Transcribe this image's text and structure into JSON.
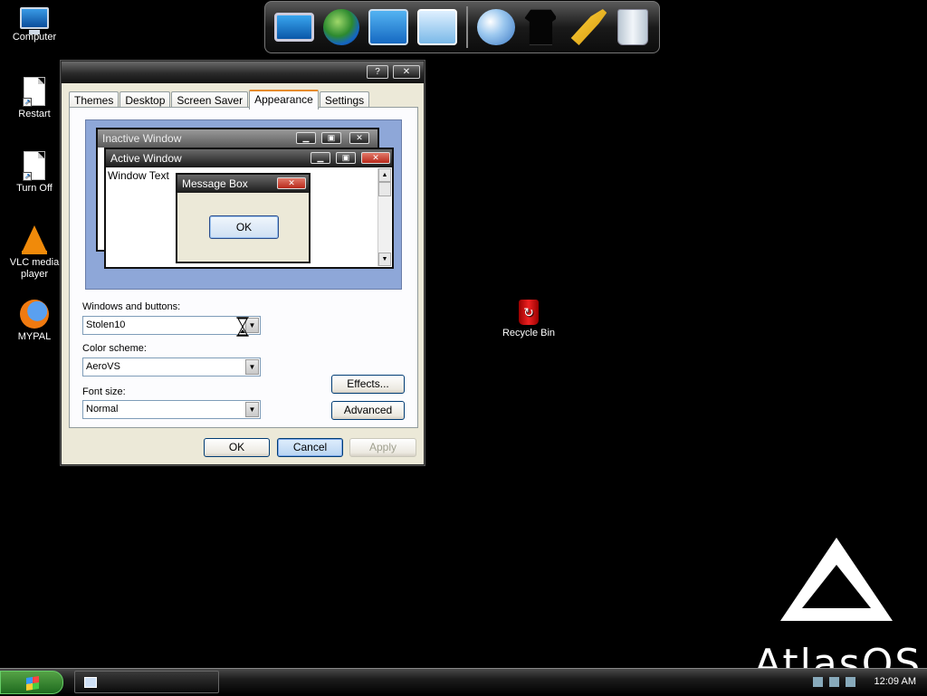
{
  "desktop": {
    "icons": [
      {
        "label": "Computer"
      },
      {
        "label": "Restart"
      },
      {
        "label": "Turn Off"
      },
      {
        "label": "VLC media player"
      },
      {
        "label": "MYPAL"
      },
      {
        "label": "Recycle Bin"
      }
    ]
  },
  "dock": {
    "items": [
      "monitor-icon",
      "globe-network-icon",
      "files-icon",
      "chart-icon",
      "internet-icon",
      "shirt-icon",
      "tools-icon",
      "recycle-bin-icon"
    ]
  },
  "dialog": {
    "help_label": "?",
    "close_label": "✕",
    "tabs": [
      {
        "label": "Themes"
      },
      {
        "label": "Desktop"
      },
      {
        "label": "Screen Saver"
      },
      {
        "label": "Appearance",
        "active": true
      },
      {
        "label": "Settings"
      }
    ],
    "preview": {
      "inactive_title": "Inactive Window",
      "active_title": "Active Window",
      "window_text": "Window Text",
      "message_title": "Message Box",
      "message_ok": "OK"
    },
    "windows_buttons": {
      "label": "Windows and buttons:",
      "value": "Stolen10"
    },
    "color_scheme": {
      "label": "Color scheme:",
      "value": "AeroVS"
    },
    "font_size": {
      "label": "Font size:",
      "value": "Normal"
    },
    "effects_label": "Effects...",
    "advanced_label": "Advanced",
    "ok_label": "OK",
    "cancel_label": "Cancel",
    "apply_label": "Apply"
  },
  "taskbar": {
    "clock": "12:09 AM"
  },
  "branding": {
    "logo_text": "AtlasOS"
  }
}
